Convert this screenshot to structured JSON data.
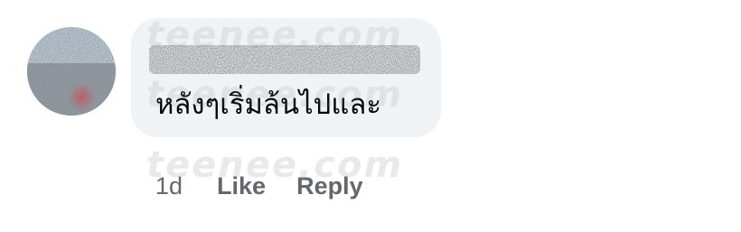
{
  "comment": {
    "author_name": "",
    "text": "หลังๆเริ่มล้นไปและ",
    "timestamp": "1d",
    "actions": {
      "like_label": "Like",
      "reply_label": "Reply"
    }
  },
  "watermark": {
    "text": "teenee.com"
  },
  "colors": {
    "bubble_background": "#f0f2f5",
    "comment_text": "#050505",
    "action_text": "#65676b"
  },
  "icons": {
    "avatar": "profile-photo-blurred"
  }
}
